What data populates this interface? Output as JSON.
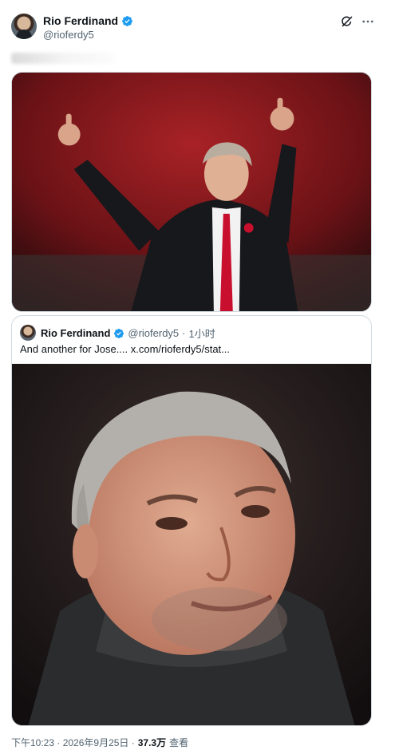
{
  "author": {
    "name": "Rio Ferdinand",
    "handle": "@rioferdy5",
    "verified": true
  },
  "icons": {
    "verified": "verified-badge-icon",
    "grok": "grok-icon",
    "more": "more-horizontal-icon"
  },
  "post": {
    "image_alt": "Manager giving two thumbs up in a stadium"
  },
  "quoted_post": {
    "name": "Rio Ferdinand",
    "handle": "@rioferdy5",
    "dot": "·",
    "time": "1小时",
    "text": "And another for Jose....  x.com/rioferdy5/stat...",
    "image_alt": "Close-up of a grey-haired man smiling in a dark jacket"
  },
  "footer": {
    "time": "下午10:23 · 2026年9月25日 ·",
    "views_count": "37.3万",
    "views_label": "查看"
  },
  "colors": {
    "accent": "#1d9bf0",
    "text_primary": "#0f1419",
    "text_secondary": "#536471",
    "border": "#cfd9de"
  }
}
